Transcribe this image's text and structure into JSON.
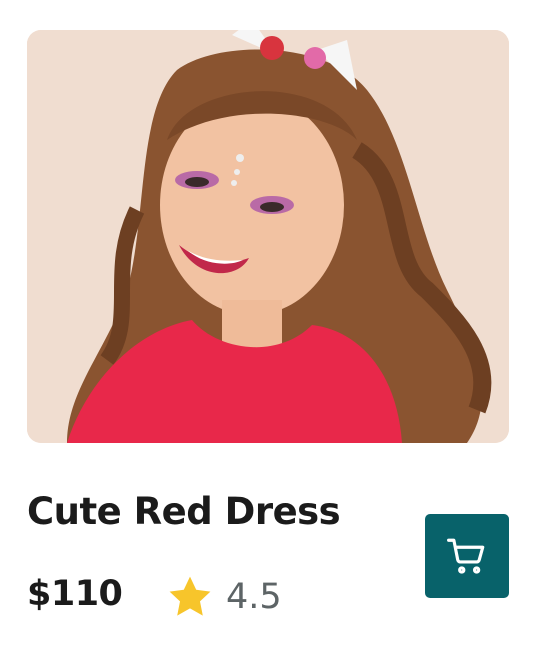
{
  "product": {
    "name": "Cute Red Dress",
    "price": "$110",
    "rating": "4.5",
    "image_alt": "Smiling girl in a red dress"
  },
  "icons": {
    "rating": "star-icon",
    "cart": "shopping-cart-icon"
  },
  "colors": {
    "cart_button": "#08626a",
    "star": "#f7c52b",
    "title_text": "#1b1b1b",
    "rating_text": "#5d6466"
  }
}
